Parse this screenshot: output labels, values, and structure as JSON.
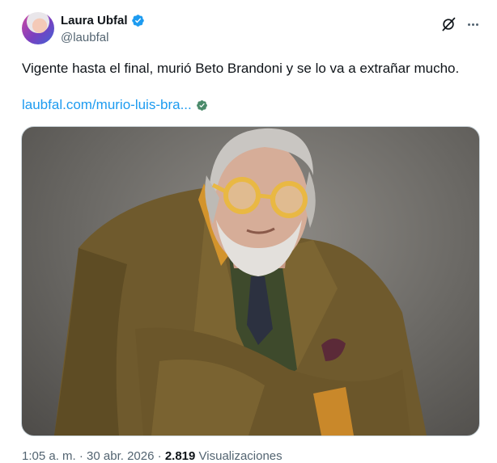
{
  "author": {
    "name": "Laura Ubfal",
    "handle": "@laubfal",
    "verified_color": "#1d9bf0"
  },
  "tweet": {
    "text": "Vigente hasta el final, murió Beto Brandoni y se lo va a extrañar mucho.",
    "link_text": "laubfal.com/murio-luis-bra...",
    "link_color": "#1d9bf0"
  },
  "meta": {
    "time": "1:05 a. m.",
    "separator": "·",
    "date": "30 abr. 2026",
    "views_count": "2.819",
    "views_label": "Visualizaciones"
  },
  "icons": {
    "grok": "grok-icon",
    "more": "more-icon",
    "verified": "verified-badge-icon",
    "link_verified": "link-verified-icon"
  }
}
